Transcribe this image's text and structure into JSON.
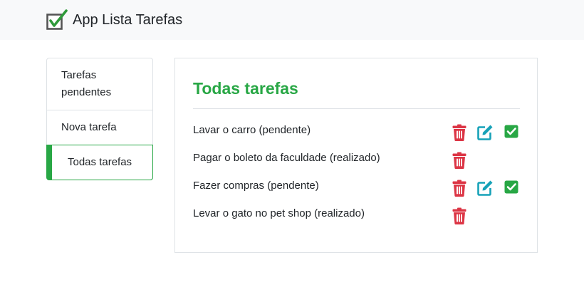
{
  "app": {
    "title": "App Lista Tarefas",
    "logo_icon": "checkbox-check-icon"
  },
  "menu": {
    "items": [
      {
        "label": "Tarefas pendentes",
        "active": false
      },
      {
        "label": "Nova tarefa",
        "active": false
      },
      {
        "label": "Todas tarefas",
        "active": true
      }
    ]
  },
  "main": {
    "title": "Todas tarefas",
    "tasks": [
      {
        "text": "Lavar o carro (pendente)",
        "actions": [
          "trash-icon",
          "edit-icon",
          "check-square-icon"
        ]
      },
      {
        "text": "Pagar o boleto da faculdade (realizado)",
        "actions": [
          "trash-icon"
        ]
      },
      {
        "text": "Fazer compras (pendente)",
        "actions": [
          "trash-icon",
          "edit-icon",
          "check-square-icon"
        ]
      },
      {
        "text": "Levar o gato no pet shop (realizado)",
        "actions": [
          "trash-icon"
        ]
      }
    ]
  },
  "colors": {
    "accent": "#28a745",
    "danger": "#dc3545",
    "info": "#17a2b8",
    "navbar_bg": "#f8f9fa",
    "border": "#dee2e6"
  }
}
